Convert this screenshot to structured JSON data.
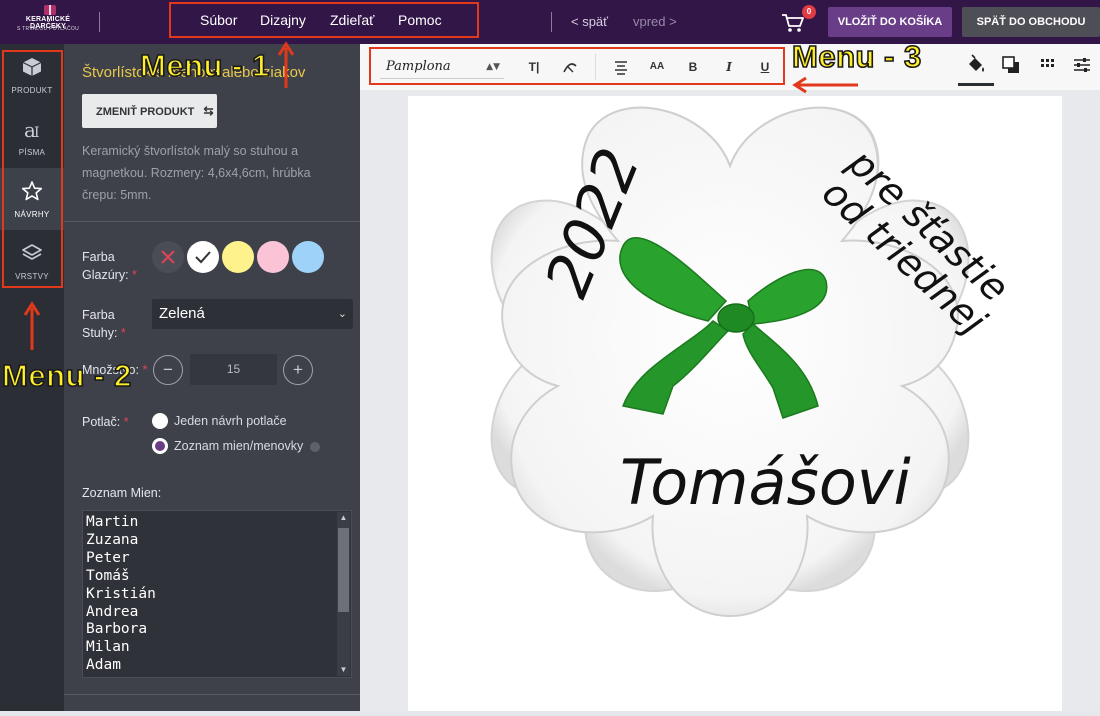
{
  "header": {
    "logo_line1": "KERAMICKÉ DARČEKY",
    "logo_line2": "S TRVALOU POTLAČOU",
    "menu": [
      "Súbor",
      "Dizajny",
      "Zdieľať",
      "Pomoc"
    ],
    "back_label": "< späť",
    "forward_label": "vpred >",
    "cart_count": "0",
    "add_to_cart_label": "VLOŽIŤ DO KOŠÍKA",
    "back_to_shop_label": "SPÄŤ DO OBCHODU"
  },
  "sidebar": {
    "items": [
      {
        "label": "PRODUKT",
        "icon": "cube-icon"
      },
      {
        "label": "PÍSMA",
        "icon": "font-icon"
      },
      {
        "label": "NÁVRHY",
        "icon": "star-icon"
      },
      {
        "label": "VRSTVY",
        "icon": "layers-icon"
      }
    ],
    "active": "NÁVRHY"
  },
  "panel": {
    "title": "Štvorlístok s menom alebo ziakov",
    "change_product_label": "ZMENIŤ PRODUKT",
    "description": "Keramický štvorlístok malý so stuhou a magnetkou. Rozmery: 4,6x4,6cm, hrúbka črepu: 5mm.",
    "glaze_label_1": "Farba",
    "glaze_label_2": "Glazúry:",
    "glaze_colors": [
      "none",
      "#ffffff",
      "#fdf28c",
      "#fbc4d6",
      "#9fd2f8"
    ],
    "ribbon_label_1": "Farba",
    "ribbon_label_2": "Stuhy:",
    "ribbon_value": "Zelená",
    "quantity_label": "Množstvo:",
    "quantity_value": "15",
    "print_label": "Potlač:",
    "print_option_1": "Jeden návrh potlače",
    "print_option_2": "Zoznam mien/menovky",
    "print_selected": 2,
    "names_label": "Zoznam Mien:",
    "names": [
      "Martin",
      "Zuzana",
      "Peter",
      "Tomáš",
      "Kristián",
      "Andrea",
      "Barbora",
      "Milan",
      "Adam"
    ]
  },
  "toolbar": {
    "font_value": "Pamplona",
    "buttons": [
      "text-size-icon",
      "curve-text-icon",
      "align-center-icon",
      "font-case-icon",
      "bold-icon",
      "italic-icon",
      "underline-icon"
    ],
    "bold_label": "B",
    "italic_label": "I",
    "underline_label": "U",
    "case_label": "AA",
    "right_tools": [
      "fill-icon",
      "shadow-icon",
      "grid-icon",
      "sliders-icon"
    ]
  },
  "canvas": {
    "year": "2022",
    "line1": "pre šťastie",
    "line2": "od triednej",
    "name": "Tomášovi"
  },
  "annotations": {
    "menu1": "Menu - 1",
    "menu2": "Menu - 2",
    "menu3": "Menu - 3"
  },
  "colors": {
    "topbar": "#321648",
    "accent": "#6a3d89",
    "panel": "#3e4149",
    "annotation_border": "#e2381b",
    "annotation_text": "#ffee2a",
    "ribbon": "#2aa32e"
  }
}
